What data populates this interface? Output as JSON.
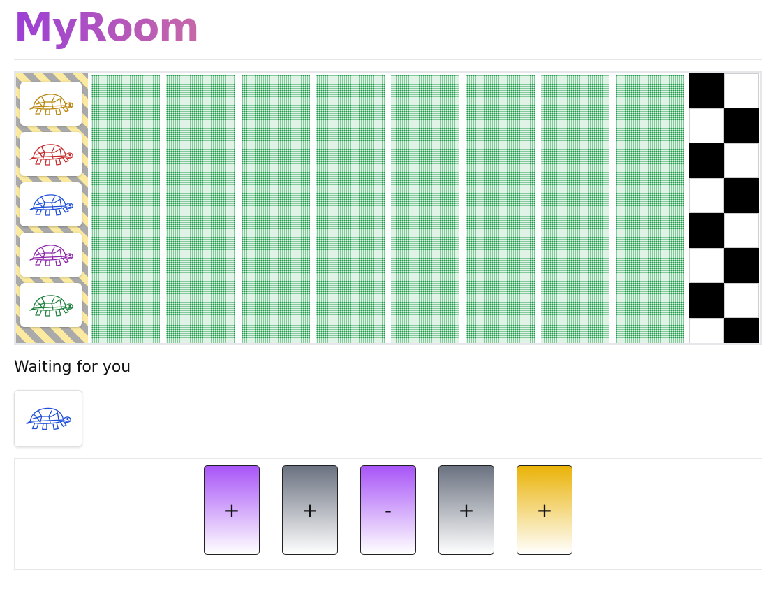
{
  "app": {
    "title": "MyRoom"
  },
  "board": {
    "turtles": [
      {
        "color_name": "orange",
        "color": "#b8860b",
        "icon": "turtle-icon"
      },
      {
        "color_name": "red",
        "color": "#c62828",
        "icon": "turtle-icon"
      },
      {
        "color_name": "blue",
        "color": "#1e4fd8",
        "icon": "turtle-icon"
      },
      {
        "color_name": "purple",
        "color": "#8e24aa",
        "icon": "turtle-icon"
      },
      {
        "color_name": "green",
        "color": "#1b7f3a",
        "icon": "turtle-icon"
      }
    ],
    "lane_count": 8,
    "finish_pattern": "checkered"
  },
  "status": {
    "text": "Waiting for you"
  },
  "player": {
    "turtle_color_name": "blue",
    "turtle_color": "#1e4fd8",
    "icon": "turtle-icon"
  },
  "hand": {
    "cards": [
      {
        "symbol": "+",
        "color_name": "purple",
        "color": "#a855f7"
      },
      {
        "symbol": "+",
        "color_name": "gray",
        "color": "#6b7280"
      },
      {
        "symbol": "-",
        "color_name": "purple",
        "color": "#a855f7"
      },
      {
        "symbol": "+",
        "color_name": "gray",
        "color": "#6b7280"
      },
      {
        "symbol": "+",
        "color_name": "yellow",
        "color": "#eab308"
      }
    ]
  }
}
